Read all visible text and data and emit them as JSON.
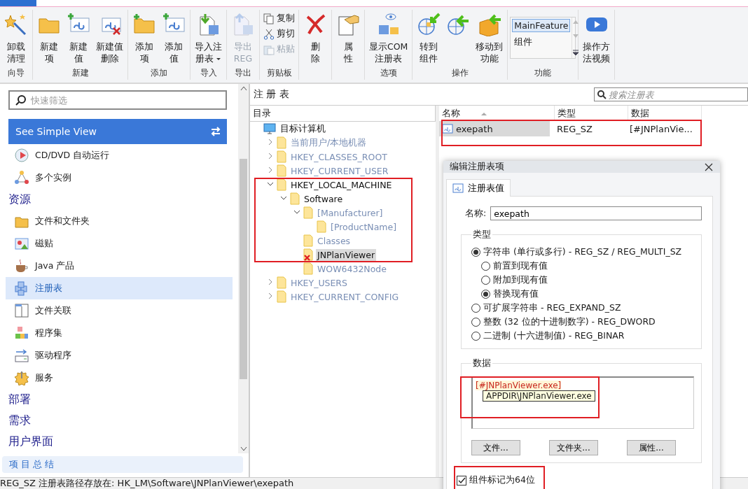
{
  "ribbon": {
    "groups": [
      {
        "label": "向导",
        "kind": "large",
        "buttons": [
          {
            "lines": [
              "卸载",
              "清理"
            ],
            "disabled": false,
            "dropdown": false
          }
        ]
      },
      {
        "label": "新建",
        "kind": "large",
        "buttons": [
          {
            "lines": [
              "新建",
              "项"
            ],
            "disabled": false,
            "dropdown": false
          },
          {
            "lines": [
              "新建",
              "值"
            ],
            "disabled": false,
            "dropdown": false
          },
          {
            "lines": [
              "新建值",
              "删除"
            ],
            "disabled": false,
            "dropdown": false
          }
        ]
      },
      {
        "label": "添加",
        "kind": "large",
        "buttons": [
          {
            "lines": [
              "添加",
              "项"
            ],
            "disabled": false,
            "dropdown": false
          },
          {
            "lines": [
              "添加",
              "值"
            ],
            "disabled": false,
            "dropdown": false
          }
        ]
      },
      {
        "label": "导入",
        "kind": "large",
        "buttons": [
          {
            "lines": [
              "导入注",
              "册表"
            ],
            "disabled": false,
            "dropdown": true
          }
        ]
      },
      {
        "label": "导出",
        "kind": "large",
        "buttons": [
          {
            "lines": [
              "导出",
              "REG"
            ],
            "disabled": true,
            "dropdown": false
          }
        ]
      },
      {
        "label": "剪贴板",
        "kind": "small",
        "buttons": [
          {
            "lines": [
              "复制"
            ],
            "disabled": false
          },
          {
            "lines": [
              "剪切"
            ],
            "disabled": false
          },
          {
            "lines": [
              "粘贴"
            ],
            "disabled": true
          }
        ]
      },
      {
        "kind": "large",
        "buttons": [
          {
            "lines": [
              "删",
              "除"
            ],
            "disabled": false,
            "dropdown": false
          }
        ]
      },
      {
        "kind": "large",
        "buttons": [
          {
            "lines": [
              "属",
              "性"
            ],
            "disabled": false,
            "dropdown": false
          }
        ]
      },
      {
        "label": "选项",
        "kind": "large",
        "buttons": [
          {
            "lines": [
              "显示COM",
              "注册表"
            ],
            "disabled": false,
            "dropdown": false
          }
        ]
      },
      {
        "label": "操作",
        "kind": "large",
        "buttons": [
          {
            "lines": [
              "转到",
              "组件"
            ],
            "disabled": false,
            "dropdown": false
          },
          {
            "disabled": false
          },
          {
            "lines": [
              "移动到",
              "功能"
            ],
            "disabled": false,
            "dropdown": false
          }
        ]
      },
      {
        "label": "功能",
        "kind": "list",
        "items": [
          {
            "label": "MainFeature",
            "selected": true
          },
          {
            "label": "组件",
            "selected": false
          }
        ]
      },
      {
        "kind": "large",
        "buttons": [
          {
            "lines": [
              "操作方",
              "法视频"
            ],
            "disabled": false,
            "dropdown": false
          }
        ]
      }
    ]
  },
  "sidebar": {
    "search": {
      "placeholder": "快速筛选"
    },
    "simple_view_button": "See Simple View",
    "items": [
      {
        "kind": "item",
        "label": "CD/DVD 自动运行",
        "selected": false
      },
      {
        "kind": "item",
        "label": "多个实例",
        "selected": false
      },
      {
        "kind": "heading",
        "label": "资源"
      },
      {
        "kind": "item",
        "label": "文件和文件夹",
        "selected": false
      },
      {
        "kind": "item",
        "label": "磁贴",
        "selected": false
      },
      {
        "kind": "item",
        "label": "Java 产品",
        "selected": false
      },
      {
        "kind": "item",
        "label": "注册表",
        "selected": true
      },
      {
        "kind": "item",
        "label": "文件关联",
        "selected": false
      },
      {
        "kind": "item",
        "label": "程序集",
        "selected": false
      },
      {
        "kind": "item",
        "label": "驱动程序",
        "selected": false
      },
      {
        "kind": "item",
        "label": "服务",
        "selected": false
      },
      {
        "kind": "heading",
        "label": "部署"
      },
      {
        "kind": "heading",
        "label": "需求"
      },
      {
        "kind": "heading",
        "label": "用户界面"
      }
    ],
    "summary_button": "项 目 总 结"
  },
  "registry": {
    "title": "注 册 表",
    "search": {
      "placeholder": "搜索注册表"
    },
    "tree": {
      "header": "目录",
      "items": [
        {
          "label": "目标计算机",
          "kind": "computer",
          "selected": false,
          "dimmed": false,
          "flagged": false,
          "children": [
            {
              "label": "当前用户/本地机器",
              "kind": "folder",
              "expanded": false,
              "selected": false,
              "dimmed": true,
              "flagged": false
            },
            {
              "label": "HKEY_CLASSES_ROOT",
              "kind": "folder",
              "expanded": false,
              "selected": false,
              "dimmed": true,
              "flagged": false
            },
            {
              "label": "HKEY_CURRENT_USER",
              "kind": "folder",
              "expanded": false,
              "selected": false,
              "dimmed": true,
              "flagged": false
            },
            {
              "label": "HKEY_LOCAL_MACHINE",
              "kind": "folder",
              "expanded": true,
              "selected": false,
              "dimmed": false,
              "flagged": false,
              "children": [
                {
                  "label": "Software",
                  "kind": "folder",
                  "expanded": true,
                  "selected": false,
                  "dimmed": false,
                  "flagged": false,
                  "children": [
                    {
                      "label": "[Manufacturer]",
                      "kind": "folder",
                      "expanded": true,
                      "selected": false,
                      "dimmed": true,
                      "flagged": false,
                      "children": [
                        {
                          "label": "[ProductName]",
                          "kind": "folder",
                          "selected": false,
                          "dimmed": true,
                          "flagged": false
                        }
                      ]
                    },
                    {
                      "label": "Classes",
                      "kind": "folder",
                      "selected": false,
                      "dimmed": true,
                      "flagged": false
                    },
                    {
                      "label": "JNPlanViewer",
                      "kind": "folder",
                      "selected": true,
                      "dimmed": false,
                      "flagged": true
                    },
                    {
                      "label": "WOW6432Node",
                      "kind": "folder",
                      "selected": false,
                      "dimmed": true,
                      "flagged": false
                    }
                  ]
                }
              ]
            },
            {
              "label": "HKEY_USERS",
              "kind": "folder",
              "expanded": false,
              "selected": false,
              "dimmed": true,
              "flagged": false
            },
            {
              "label": "HKEY_CURRENT_CONFIG",
              "kind": "folder",
              "expanded": false,
              "selected": false,
              "dimmed": true,
              "flagged": false
            }
          ]
        }
      ]
    },
    "list": {
      "columns": [
        {
          "label": "名称",
          "sorted": true
        },
        {
          "label": "类型",
          "sorted": false
        },
        {
          "label": "数据",
          "sorted": false
        }
      ],
      "rows": [
        {
          "selected": true,
          "cells": [
            "exepath",
            "REG_SZ",
            "[#JNPlanVie..."
          ]
        }
      ]
    }
  },
  "dialog": {
    "title": "编辑注册表项",
    "tab": "注册表值",
    "name_label": "名称:",
    "name_value": "exepath",
    "type_group": "类型",
    "options": [
      {
        "kind": "main",
        "label": "字符串 (单行或多行) - REG_SZ / REG_MULTI_SZ",
        "selected": true
      },
      {
        "kind": "sub",
        "label": "前置到现有值",
        "selected": false
      },
      {
        "kind": "sub",
        "label": "附加到现有值",
        "selected": false
      },
      {
        "kind": "sub",
        "label": "替换现有值",
        "selected": true
      },
      {
        "kind": "main",
        "label": "可扩展字符串 - REG_EXPAND_SZ",
        "selected": false
      },
      {
        "kind": "main",
        "label": "整数 (32 位的十进制数字) - REG_DWORD",
        "selected": false
      },
      {
        "kind": "main",
        "label": "二进制 (十六进制值) - REG_BINAR",
        "selected": false
      }
    ],
    "data_group": "数据",
    "data_value": "[#JNPlanViewer.exe]",
    "tooltip": "APPDIR\\JNPlanViewer.exe",
    "buttons": [
      "文件...",
      "文件夹...",
      "属性..."
    ],
    "checkbox": {
      "label": "组件标记为64位",
      "checked": true
    }
  },
  "status_bar": "REG_SZ 注册表路径存放在: HK_LM\\Software\\JNPlanViewer\\exepath"
}
